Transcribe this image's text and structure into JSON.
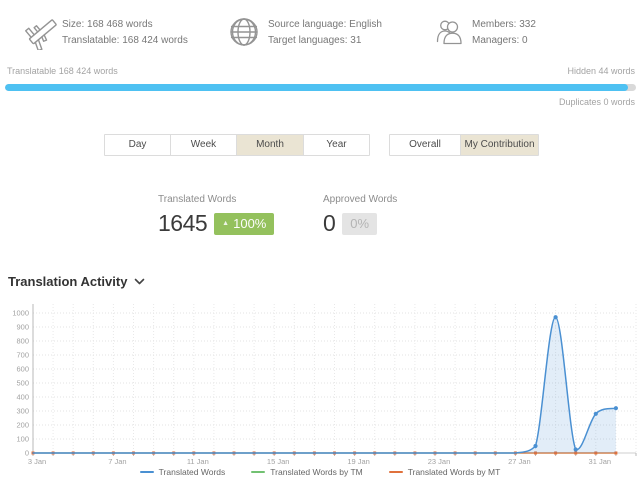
{
  "header": {
    "size": {
      "icon": "caliper-icon",
      "line1": "Size: 168 468 words",
      "line2": "Translatable: 168 424 words"
    },
    "language": {
      "icon": "globe-icon",
      "line1": "Source language: English",
      "line2": "Target languages: 31"
    },
    "members": {
      "icon": "members-icon",
      "line1": "Members: 332",
      "line2": "Managers: 0"
    }
  },
  "progress": {
    "left_label": "Translatable 168 424 words",
    "right_label": "Hidden 44 words",
    "duplicates_label": "Duplicates 0 words",
    "fill_percent": 98.7,
    "bar_color": "#4ec1f2",
    "remainder_color": "#d9d9d9"
  },
  "tabs": {
    "time": [
      {
        "label": "Day",
        "active": false
      },
      {
        "label": "Week",
        "active": false
      },
      {
        "label": "Month",
        "active": true
      },
      {
        "label": "Year",
        "active": false
      }
    ],
    "scope": [
      {
        "label": "Overall",
        "active": false
      },
      {
        "label": "My Contribution",
        "active": true
      }
    ]
  },
  "stats": [
    {
      "label": "Translated Words",
      "value": "1645",
      "badge_arrow": "▲",
      "badge_text": "100%",
      "badge_style": "positive"
    },
    {
      "label": "Approved Words",
      "value": "0",
      "badge_arrow": "",
      "badge_text": "0%",
      "badge_style": "neutral"
    }
  ],
  "section": {
    "title": "Translation Activity"
  },
  "chart_data": {
    "type": "area",
    "title": "Translation Activity",
    "x": [
      "3 Jan",
      "4 Jan",
      "5 Jan",
      "6 Jan",
      "7 Jan",
      "8 Jan",
      "9 Jan",
      "10 Jan",
      "11 Jan",
      "12 Jan",
      "13 Jan",
      "14 Jan",
      "15 Jan",
      "16 Jan",
      "17 Jan",
      "18 Jan",
      "19 Jan",
      "20 Jan",
      "21 Jan",
      "22 Jan",
      "23 Jan",
      "24 Jan",
      "25 Jan",
      "26 Jan",
      "27 Jan",
      "28 Jan",
      "29 Jan",
      "30 Jan",
      "31 Jan",
      "1 Feb",
      "2 Feb"
    ],
    "series": [
      {
        "name": "Translated Words",
        "color": "#4a90d2",
        "fill": "rgba(74,144,210,0.16)",
        "values": [
          0,
          0,
          0,
          0,
          0,
          0,
          0,
          0,
          0,
          0,
          0,
          0,
          0,
          0,
          0,
          0,
          0,
          0,
          0,
          0,
          0,
          0,
          0,
          0,
          0,
          50,
          970,
          25,
          280,
          320,
          null
        ]
      },
      {
        "name": "Translated Words by TM",
        "color": "#72c172",
        "fill": "none",
        "values": [
          0,
          0,
          0,
          0,
          0,
          0,
          0,
          0,
          0,
          0,
          0,
          0,
          0,
          0,
          0,
          0,
          0,
          0,
          0,
          0,
          0,
          0,
          0,
          0,
          0,
          0,
          0,
          0,
          0,
          0,
          null
        ]
      },
      {
        "name": "Translated Words by MT",
        "color": "#e0713c",
        "fill": "none",
        "values": [
          0,
          0,
          0,
          0,
          0,
          0,
          0,
          0,
          0,
          0,
          0,
          0,
          0,
          0,
          0,
          0,
          0,
          0,
          0,
          0,
          0,
          0,
          0,
          0,
          0,
          0,
          0,
          0,
          0,
          0,
          null
        ]
      }
    ],
    "xtick_every": 4,
    "xtick_labels": [
      "3 Jan",
      "7 Jan",
      "11 Jan",
      "15 Jan",
      "19 Jan",
      "23 Jan",
      "27 Jan",
      "31 Jan"
    ],
    "ylim": [
      0,
      1000
    ],
    "ytick_step": 100,
    "grid": "dotted",
    "legend_position": "bottom"
  }
}
